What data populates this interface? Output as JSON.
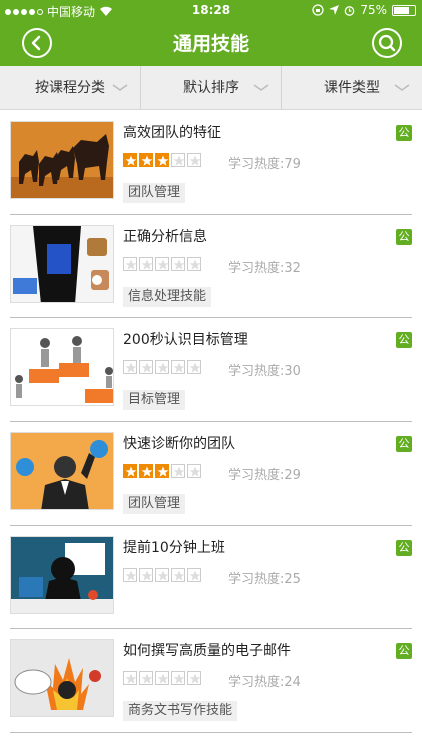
{
  "status": {
    "carrier": "中国移动",
    "time": "18:28",
    "battery": "75%",
    "battery_level": 0.75
  },
  "nav": {
    "title": "通用技能"
  },
  "filters": [
    {
      "label": "按课程分类"
    },
    {
      "label": "默认排序"
    },
    {
      "label": "课件类型"
    }
  ],
  "colors": {
    "accent": "#62ad22",
    "star": "#f08a00"
  },
  "courses": [
    {
      "title": "高效团队的特征",
      "rating": 3,
      "heat": "学习热度:79",
      "tag": "团队管理",
      "badge": "公",
      "thumb": "wolves-bull"
    },
    {
      "title": "正确分析信息",
      "rating": 0,
      "heat": "学习热度:32",
      "tag": "信息处理技能",
      "badge": "公",
      "thumb": "robots-screen"
    },
    {
      "title": "200秒认识目标管理",
      "rating": 0,
      "heat": "学习热度:30",
      "tag": "目标管理",
      "badge": "公",
      "thumb": "figures-wall"
    },
    {
      "title": "快速诊断你的团队",
      "rating": 3,
      "heat": "学习热度:29",
      "tag": "团队管理",
      "badge": "公",
      "thumb": "businessman"
    },
    {
      "title": "提前10分钟上班",
      "rating": 0,
      "heat": "学习热度:25",
      "tag": "",
      "badge": "公",
      "thumb": "person-desk"
    },
    {
      "title": "如何撰写高质量的电子邮件",
      "rating": 0,
      "heat": "学习热度:24",
      "tag": "商务文书写作技能",
      "badge": "公",
      "thumb": "flames-head"
    }
  ]
}
